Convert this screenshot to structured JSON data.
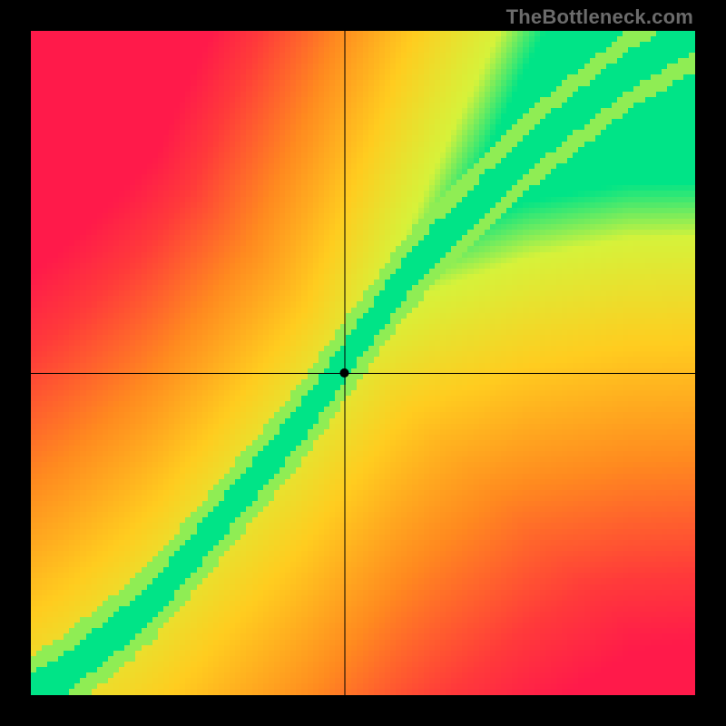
{
  "watermark": "TheBottleneck.com",
  "chart_data": {
    "type": "heatmap",
    "title": "",
    "xlabel": "",
    "ylabel": "",
    "xlim": [
      0,
      1
    ],
    "ylim": [
      0,
      1
    ],
    "grid_resolution": 120,
    "crosshair": {
      "x": 0.472,
      "y": 0.485
    },
    "marker": {
      "x": 0.472,
      "y": 0.485,
      "radius": 5,
      "color": "#000000"
    },
    "curve": {
      "description": "optimal-ratio ridge (green band) — approximate y-values sampled at evenly spaced x",
      "x_step": 0.05,
      "y": [
        0.0,
        0.03,
        0.07,
        0.11,
        0.16,
        0.22,
        0.28,
        0.34,
        0.4,
        0.47,
        0.54,
        0.61,
        0.67,
        0.72,
        0.77,
        0.82,
        0.86,
        0.9,
        0.94,
        0.97,
        1.0
      ]
    },
    "band_width_fraction": 0.06,
    "color_scale": {
      "description": "distance from ridge, center=green → yellow → orange → red; scaled toward yellow near top-right",
      "stops": [
        {
          "t": 0.0,
          "color": "#00e487"
        },
        {
          "t": 0.12,
          "color": "#d6f23a"
        },
        {
          "t": 0.35,
          "color": "#ffcc1f"
        },
        {
          "t": 0.6,
          "color": "#ff8a1f"
        },
        {
          "t": 0.85,
          "color": "#ff3a3a"
        },
        {
          "t": 1.0,
          "color": "#ff1a4a"
        }
      ]
    },
    "corner_bias": {
      "description": "top-right warms toward yellow, bottom-left toward red",
      "top_right_yellow": 0.55,
      "bottom_left_red": 0.25
    }
  }
}
